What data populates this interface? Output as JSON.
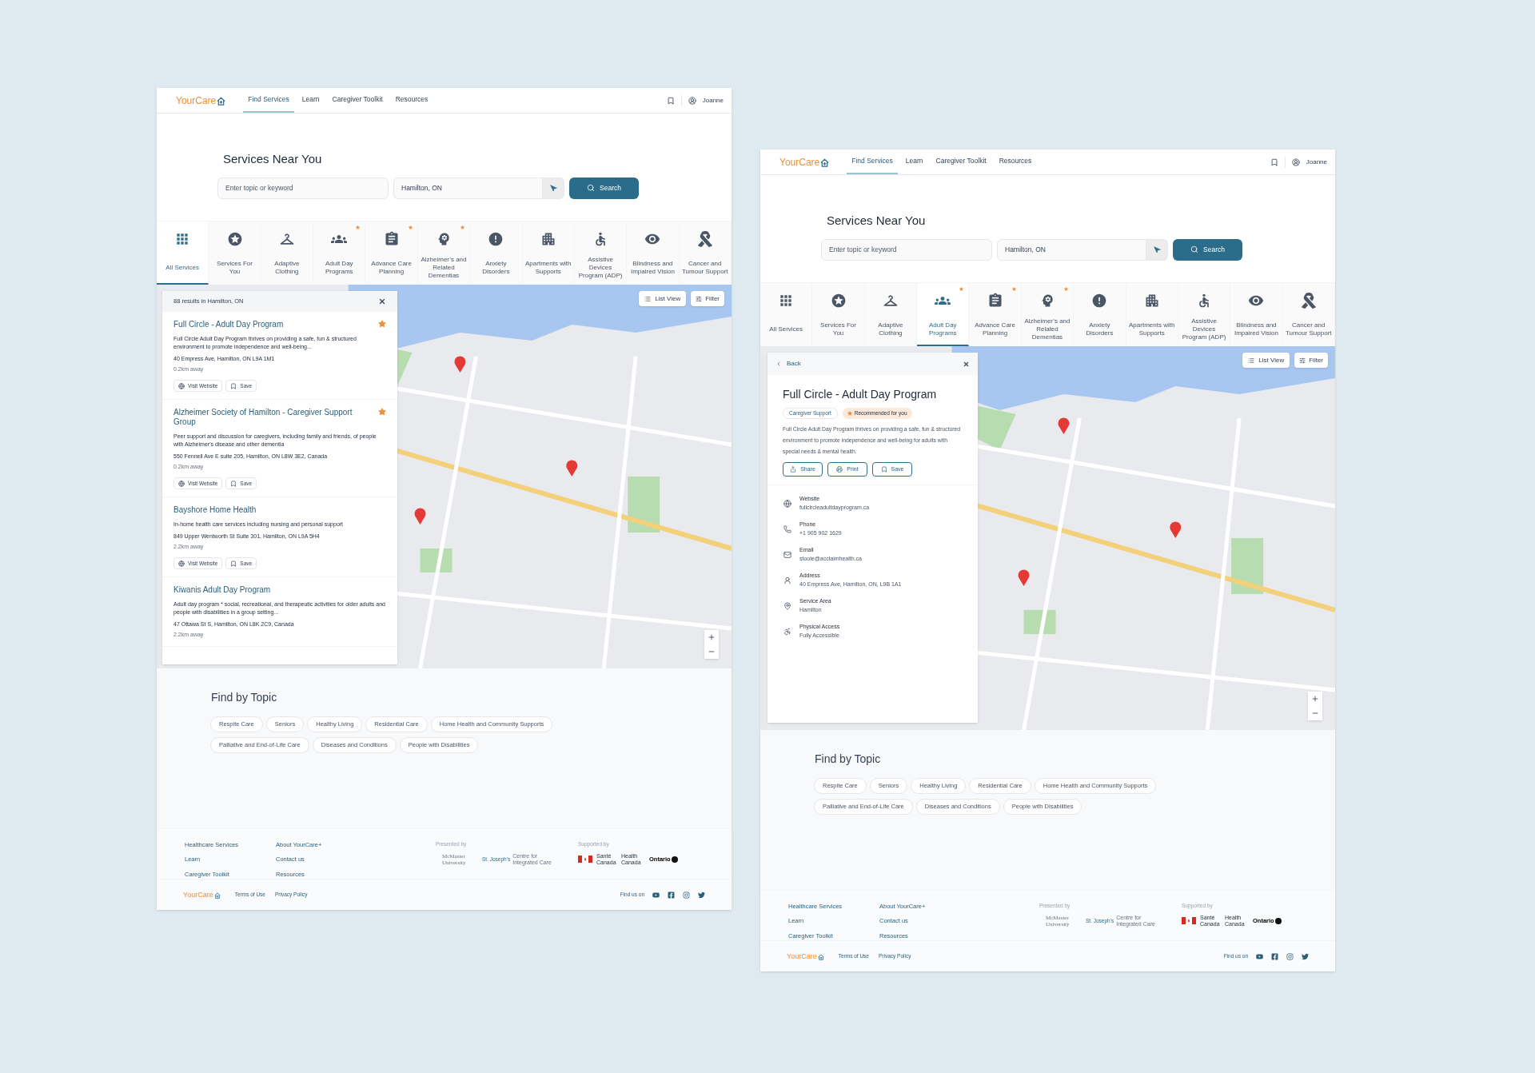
{
  "pages": [
    {
      "header": {
        "logo": "YourCare",
        "nav": [
          {
            "label": "Find Services",
            "selected": true
          },
          {
            "label": "Learn",
            "selected": false
          },
          {
            "label": "Caregiver Toolkit",
            "selected": false
          },
          {
            "label": "Resources",
            "selected": false
          }
        ],
        "user": "Joanne"
      },
      "search": {
        "title": "Services Near You",
        "keyword_placeholder": "Enter topic or keyword",
        "location": "Hamilton, ON",
        "button": "Search"
      },
      "categories": [
        {
          "label": "All Services",
          "selected": true,
          "flagged": false
        },
        {
          "label": "Services For You",
          "selected": false,
          "flagged": false
        },
        {
          "label": "Adaptive Clothing",
          "selected": false,
          "flagged": false
        },
        {
          "label": "Adult Day Programs",
          "selected": false,
          "flagged": true
        },
        {
          "label": "Advance Care Planning",
          "selected": false,
          "flagged": true
        },
        {
          "label": "Alzheimer’s and Related Dementias",
          "selected": false,
          "flagged": true
        },
        {
          "label": "Anxiety Disorders",
          "selected": false,
          "flagged": false
        },
        {
          "label": "Apartments with Supports",
          "selected": false,
          "flagged": false
        },
        {
          "label": "Assistive Devices Program (ADP)",
          "selected": false,
          "flagged": false
        },
        {
          "label": "Blindness and Impaired Vision",
          "selected": false,
          "flagged": false
        },
        {
          "label": "Cancer and Tumour Support",
          "selected": false,
          "flagged": false
        }
      ],
      "map": {
        "list_view": "List View",
        "filter": "Filter"
      },
      "panel": {
        "kind": "results",
        "summary": "88 results in Hamilton, ON",
        "items": [
          {
            "title": "Full Circle - Adult Day Program",
            "starred": true,
            "description": "Full Circle Adult Day Program thrives on providing a safe, fun & structured environment to promote independence and well-being...",
            "address": "40 Empress Ave, Hamilton, ON L9A 1M1",
            "distance": "0.2km away",
            "actions": [
              "Visit Website",
              "Save"
            ]
          },
          {
            "title": "Alzheimer Society of Hamilton - Caregiver Support Group",
            "starred": true,
            "description": "Peer support and discussion for caregivers, including family and friends, of people with Alzheimer's disease and other dementia",
            "address": "550 Fennell Ave E suite 205, Hamilton, ON L8W 3E2, Canada",
            "distance": "0.2km away",
            "actions": [
              "Visit Website",
              "Save"
            ]
          },
          {
            "title": "Bayshore Home Health",
            "starred": false,
            "description": "In-home health care services including nursing and personal support",
            "address": "849 Upper Wentworth St Suite 301, Hamilton, ON L9A 5H4",
            "distance": "2.2km away",
            "actions": [
              "Visit Website",
              "Save"
            ]
          },
          {
            "title": "Kiwanis Adult Day Program",
            "starred": false,
            "description": "Adult day program * social, recreational, and therapeutic activities for older adults and people with disabilities in a group setting...",
            "address": "47 Ottawa St S, Hamilton, ON L8K 2C9, Canada",
            "distance": "2.2km away"
          }
        ]
      },
      "topics": {
        "title": "Find by Topic",
        "chips": [
          "Respite Care",
          "Seniors",
          "Healthy Living",
          "Residential Care",
          "Home Health and Community Supports",
          "Palliative and End-of-Life Care",
          "Diseases and Conditions",
          "People with Disabilities"
        ]
      },
      "footer": {
        "links_1": [
          "Healthcare Services",
          "Learn",
          "Caregiver Toolkit"
        ],
        "links_2": [
          "About YourCare+",
          "Contact us",
          "Resources"
        ],
        "presented_by": "Presented by",
        "supported_by": "Supported by",
        "partners": [
          "McMaster University",
          "St. Joseph's",
          "Centre for Integrated Care",
          "Santé Canada",
          "Health Canada",
          "Ontario"
        ],
        "logo": "YourCare",
        "legal": [
          "Terms of Use",
          "Privacy Policy"
        ],
        "find_us": "Find us on"
      }
    },
    {
      "header": {
        "logo": "YourCare",
        "nav": [
          {
            "label": "Find Services",
            "selected": true
          },
          {
            "label": "Learn",
            "selected": false
          },
          {
            "label": "Caregiver Toolkit",
            "selected": false
          },
          {
            "label": "Resources",
            "selected": false
          }
        ],
        "user": "Joanne"
      },
      "search": {
        "title": "Services Near You",
        "keyword_placeholder": "Enter topic or keyword",
        "location": "Hamilton, ON",
        "button": "Search"
      },
      "categories": [
        {
          "label": "All Services",
          "selected": false,
          "flagged": false
        },
        {
          "label": "Services For You",
          "selected": false,
          "flagged": false
        },
        {
          "label": "Adaptive Clothing",
          "selected": false,
          "flagged": false
        },
        {
          "label": "Adult Day Programs",
          "selected": true,
          "flagged": true
        },
        {
          "label": "Advance Care Planning",
          "selected": false,
          "flagged": true
        },
        {
          "label": "Alzheimer’s and Related Dementias",
          "selected": false,
          "flagged": true
        },
        {
          "label": "Anxiety Disorders",
          "selected": false,
          "flagged": false
        },
        {
          "label": "Apartments with Supports",
          "selected": false,
          "flagged": false
        },
        {
          "label": "Assistive Devices Program (ADP)",
          "selected": false,
          "flagged": false
        },
        {
          "label": "Blindness and Impaired Vision",
          "selected": false,
          "flagged": false
        },
        {
          "label": "Cancer and Tumour Support",
          "selected": false,
          "flagged": false
        }
      ],
      "map": {
        "list_view": "List View",
        "filter": "Filter"
      },
      "panel": {
        "kind": "detail",
        "back": "Back",
        "title": "Full Circle - Adult Day Program",
        "tags": [
          {
            "label": "Caregiver Support",
            "kind": "category"
          },
          {
            "label": "Recommended for you",
            "kind": "recommended"
          }
        ],
        "description": "Full Circle Adult Day Program thrives on providing a safe, fun & structured environment to promote independence and well-being for adults with special needs & mental health.",
        "actions": [
          "Share",
          "Print",
          "Save"
        ],
        "info": [
          {
            "label": "Website",
            "value": "fullcircleadultdayprogram.ca"
          },
          {
            "label": "Phone",
            "value": "+1 905 902 1629"
          },
          {
            "label": "Email",
            "value": "stoole@acclaimhealth.ca"
          },
          {
            "label": "Address",
            "value": "40 Empress Ave, Hamilton, ON, L9B 1A1"
          },
          {
            "label": "Service Area",
            "value": "Hamilton"
          },
          {
            "label": "Physical Access",
            "value": "Fully Accessible"
          }
        ]
      },
      "topics": {
        "title": "Find by Topic",
        "chips": [
          "Respite Care",
          "Seniors",
          "Healthy Living",
          "Residential Care",
          "Home Health and Community Supports",
          "Palliative and End-of-Life Care",
          "Diseases and Conditions",
          "People with Disabilities"
        ]
      },
      "footer": {
        "links_1": [
          "Healthcare Services",
          "Learn",
          "Caregiver Toolkit"
        ],
        "links_2": [
          "About YourCare+",
          "Contact us",
          "Resources"
        ],
        "presented_by": "Presented by",
        "supported_by": "Supported by",
        "partners": [
          "McMaster University",
          "St. Joseph's",
          "Centre for Integrated Care",
          "Santé Canada",
          "Health Canada",
          "Ontario"
        ],
        "logo": "YourCare",
        "legal": [
          "Terms of Use",
          "Privacy Policy"
        ],
        "find_us": "Find us on"
      }
    }
  ]
}
